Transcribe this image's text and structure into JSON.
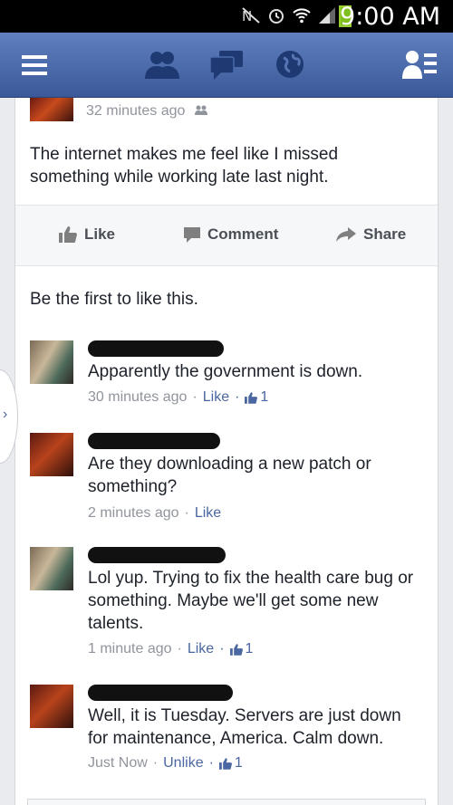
{
  "status_bar": {
    "time": "9:00 AM"
  },
  "post": {
    "time": "32 minutes ago",
    "text": "The internet makes me feel like I missed something while working late last night.",
    "actions": {
      "like": "Like",
      "comment": "Comment",
      "share": "Share"
    },
    "likes_summary": "Be the first to like this."
  },
  "comments": [
    {
      "text": "Apparently the government is down.",
      "time": "30 minutes ago",
      "like_label": "Like",
      "like_count": "1"
    },
    {
      "text": "Are they downloading a new patch or something?",
      "time": "2 minutes ago",
      "like_label": "Like",
      "like_count": ""
    },
    {
      "text": "Lol yup. Trying to fix the health care bug or something. Maybe we'll get some new talents.",
      "time": "1 minute ago",
      "like_label": "Like",
      "like_count": "1"
    },
    {
      "text": "Well, it is Tuesday. Servers are just down for maintenance, America. Calm down.",
      "time": "Just Now",
      "like_label": "Unlike",
      "like_count": "1"
    }
  ],
  "colors": {
    "brand": "#3b5998",
    "link": "#4b67a1",
    "muted": "#90949c"
  },
  "icons": [
    "menu-icon",
    "friend-requests-icon",
    "messages-icon",
    "notifications-globe-icon",
    "contacts-icon",
    "audience-friends-icon",
    "thumbs-up-icon",
    "comment-icon",
    "share-icon"
  ]
}
